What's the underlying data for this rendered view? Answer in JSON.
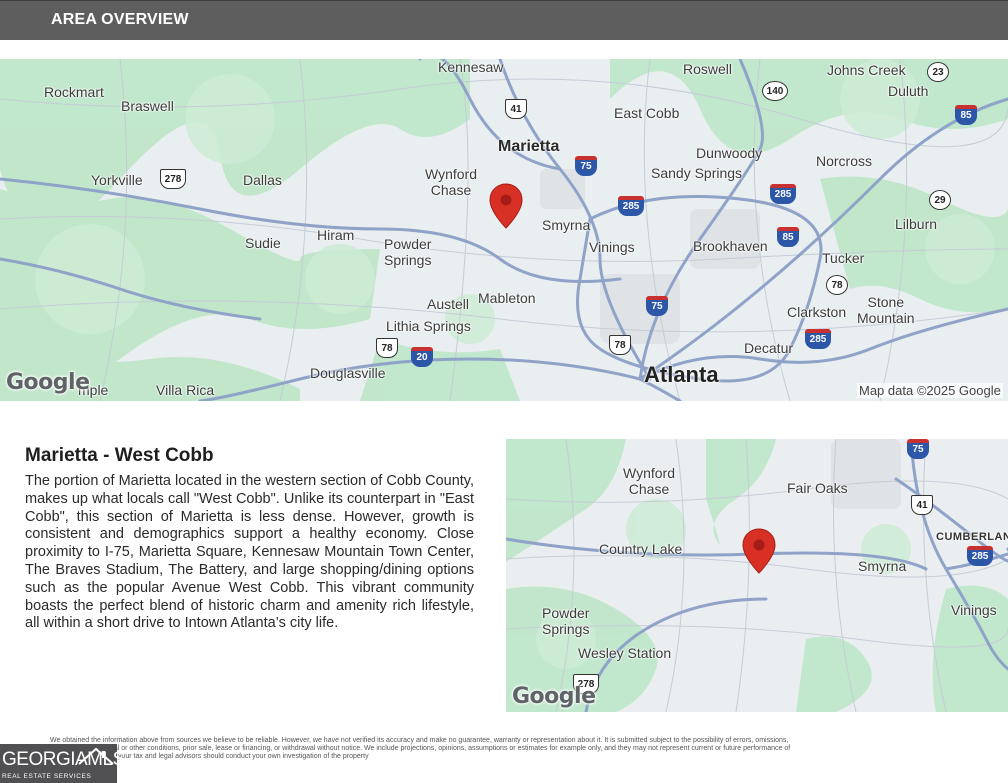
{
  "header": {
    "title": "AREA OVERVIEW"
  },
  "map_top": {
    "labels": {
      "kennesaw": "Kennesaw",
      "roswell": "Roswell",
      "johns_creek": "Johns Creek",
      "rockmart": "Rockmart",
      "braswell": "Braswell",
      "duluth": "Duluth",
      "east_cobb": "East Cobb",
      "marietta": "Marietta",
      "dunwoody": "Dunwoody",
      "norcross": "Norcross",
      "yorkville": "Yorkville",
      "dallas": "Dallas",
      "wynford_chase": "Wynford\nChase",
      "sandy_springs": "Sandy Springs",
      "smyrna": "Smyrna",
      "lilburn": "Lilburn",
      "sudie": "Sudie",
      "hiram": "Hiram",
      "powder_springs": "Powder\nSprings",
      "vinings": "Vinings",
      "brookhaven": "Brookhaven",
      "tucker": "Tucker",
      "austell": "Austell",
      "mableton": "Mableton",
      "stone_mountain": "Stone\nMountain",
      "lithia_springs": "Lithia Springs",
      "clarkston": "Clarkston",
      "decatur": "Decatur",
      "douglasville": "Douglasville",
      "atlanta": "Atlanta",
      "temple": "mple",
      "villa_rica": "Villa Rica"
    },
    "shields": {
      "s23": "23",
      "s140": "140",
      "s85a": "85",
      "s41": "41",
      "s75a": "75",
      "s278": "278",
      "s285a": "285",
      "s285b": "285",
      "s29": "29",
      "s85b": "85",
      "s78a": "78",
      "s75b": "75",
      "s78b": "78",
      "s20": "20",
      "s78c": "78",
      "s285c": "285"
    },
    "google": "Google",
    "attribution": "Map data ©2025 Google"
  },
  "map_bottom": {
    "labels": {
      "wynford_chase": "Wynford\nChase",
      "fair_oaks": "Fair Oaks",
      "cumberland": "CUMBERLAND",
      "country_lake": "Country Lake",
      "smyrna": "Smyrna",
      "powder_springs": "Powder\nSprings",
      "vinings": "Vinings",
      "wesley_station": "Wesley Station"
    },
    "shields": {
      "s75": "75",
      "s41": "41",
      "s285": "285",
      "s278": "278"
    },
    "google": "Google"
  },
  "area": {
    "title": "Marietta - West Cobb",
    "description": "The portion of Marietta located in the western section of Cobb County, makes up what locals call \"West Cobb\". Unlike its counterpart in \"East Cobb\", this section of Marietta is less dense. However, growth is consistent and demographics support a healthy economy. Close proximity to I-75, Marietta Square, Kennesaw Mountain Town Center, The Braves Stadium, The Battery, and large shopping/dining options such as the popular Avenue West Cobb. This vibrant community boasts the perfect blend of historic charm and amenity rich lifestyle, all within a short drive to Intown Atlanta’s city life."
  },
  "disclaimer": "We obtained the information above from sources we believe to be reliable. However, we have not verified its accuracy and make no guarantee, warranty or representation about it. It is submitted subject to the possibility of errors, omissions, change of price, rental or other conditions, prior sale, lease or financing, or withdrawal without notice. We include projections, opinions, assumptions or estimates for example only, and they may not represent current or future performance of the property. You and your tax and legal advisors should conduct your own investigation of the property",
  "brand": {
    "name": "GEORGIAMLS",
    "tagline": "REAL ESTATE SERVICES"
  },
  "colors": {
    "header_bg": "#5e5e5e",
    "pin": "#d93025",
    "interstate": "#2c56a8",
    "badge_bg": "#505052"
  }
}
